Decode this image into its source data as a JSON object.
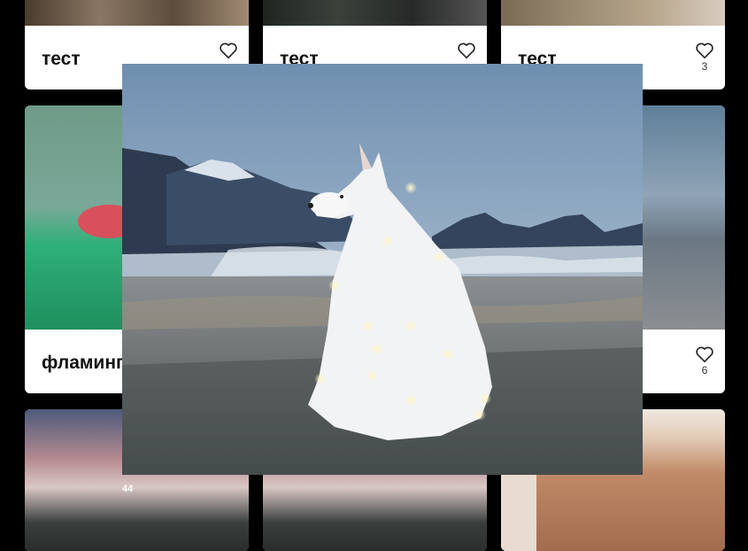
{
  "gallery": {
    "cards": [
      {
        "title": "тест",
        "likes": ""
      },
      {
        "title": "тест",
        "likes": ""
      },
      {
        "title": "тест",
        "likes": "3"
      },
      {
        "title": "фламинго",
        "likes": ""
      },
      {
        "title": "",
        "likes": ""
      },
      {
        "title": "",
        "likes": "6"
      },
      {
        "title": "",
        "likes": ""
      },
      {
        "title": "",
        "likes": ""
      },
      {
        "title": "",
        "likes": ""
      }
    ],
    "badge_text": "44"
  },
  "modal": {
    "image_subject": "white samoyed dog with fairy lights in front of mountains",
    "close_icon": "close-icon"
  },
  "colors": {
    "background": "#000000",
    "card_footer": "#ffffff",
    "close": "#ffffff"
  }
}
